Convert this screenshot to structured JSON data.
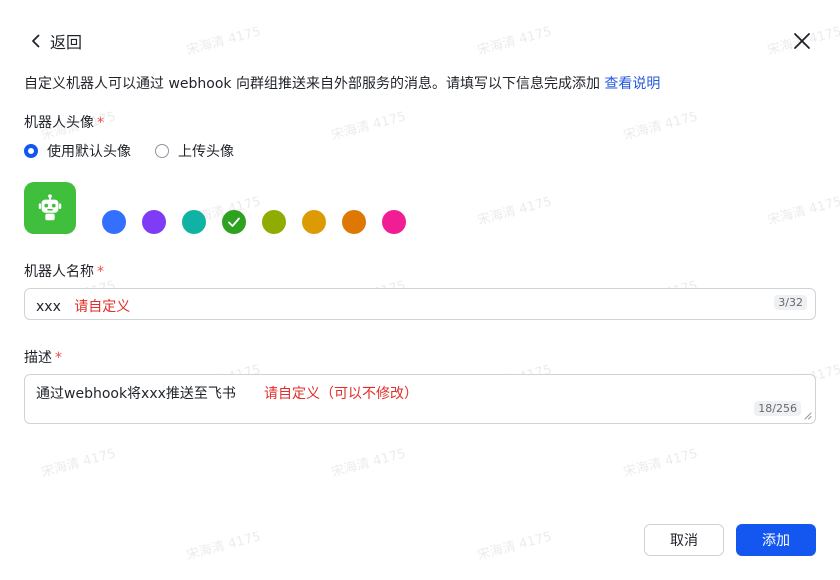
{
  "header": {
    "back_label": "返回"
  },
  "description": {
    "text": "自定义机器人可以通过 webhook 向群组推送来自外部服务的消息。请填写以下信息完成添加 ",
    "link": "查看说明"
  },
  "avatar_section": {
    "label": "机器人头像",
    "required_mark": "*",
    "options": [
      {
        "label": "使用默认头像",
        "selected": true
      },
      {
        "label": "上传头像",
        "selected": false
      }
    ],
    "avatar_icon": "robot-icon",
    "avatar_color": "#3fbf3c",
    "colors": [
      "#3370ff",
      "#7f3bf5",
      "#10b3a3",
      "#2ea121",
      "#8fac02",
      "#dc9b04",
      "#de7802",
      "#f01d94"
    ],
    "selected_color_index": 3
  },
  "name_section": {
    "label": "机器人名称",
    "required_mark": "*",
    "value": "xxx",
    "hint": "请自定义",
    "counter": "3/32"
  },
  "desc_section": {
    "label": "描述",
    "required_mark": "*",
    "value": "通过webhook将xxx推送至飞书",
    "hint": "请自定义（可以不修改）",
    "counter": "18/256"
  },
  "footer": {
    "cancel_label": "取消",
    "add_label": "添加"
  },
  "watermark": "宋海清 4175"
}
